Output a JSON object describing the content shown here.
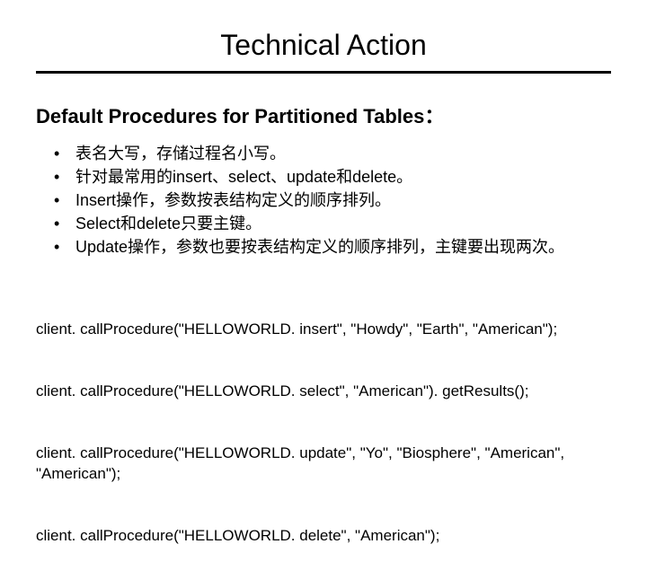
{
  "title": "Technical Action",
  "subtitle": "Default Procedures for Partitioned Tables：",
  "bullets": [
    "表名大写，存储过程名小写。",
    "针对最常用的insert、select、update和delete。",
    "Insert操作，参数按表结构定义的顺序排列。",
    "Select和delete只要主键。",
    "Update操作，参数也要按表结构定义的顺序排列，主键要出现两次。"
  ],
  "code_lines": [
    "client. callProcedure(\"HELLOWORLD. insert\", \"Howdy\", \"Earth\", \"American\");",
    "client. callProcedure(\"HELLOWORLD. select\", \"American\"). getResults();",
    "client. callProcedure(\"HELLOWORLD. update\", \"Yo\", \"Biosphere\", \"American\", \"American\");",
    "client. callProcedure(\"HELLOWORLD. delete\", \"American\");"
  ]
}
